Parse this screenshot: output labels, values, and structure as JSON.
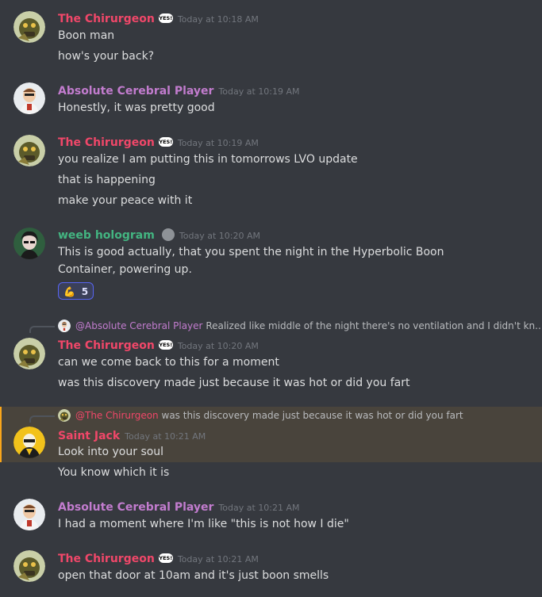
{
  "colors": {
    "chirurgeon": "#f04769",
    "absolute": "#c27cce",
    "weeb": "#43b581",
    "saintjack": "#f04769",
    "background": "#36393f",
    "mention_highlight": "#49443c"
  },
  "badge_text": "YES!",
  "messages": [
    {
      "author": "The Chirurgeon",
      "timestamp": "Today at 10:18 AM",
      "lines": [
        "Boon man",
        "how's your back?"
      ]
    },
    {
      "author": "Absolute Cerebral Player",
      "timestamp": "Today at 10:19 AM",
      "lines": [
        "Honestly, it was pretty good"
      ]
    },
    {
      "author": "The Chirurgeon",
      "timestamp": "Today at 10:19 AM",
      "lines": [
        "you realize I am putting this in tomorrows LVO update",
        "that is happening",
        "make your peace with it"
      ]
    },
    {
      "author": "weeb hologram",
      "timestamp": "Today at 10:20 AM",
      "lines": [
        "This is good actually, that you spent the night in the Hyperbolic Boon Container, powering up."
      ],
      "reaction": {
        "icon": "flexed-arm-icon",
        "count": "5"
      }
    },
    {
      "author": "The Chirurgeon",
      "timestamp": "Today at 10:20 AM",
      "reply": {
        "mention": "@Absolute Cerebral Player",
        "text": "Realized like middle of the night there's no ventilation and I didn't kn..."
      },
      "lines": [
        "can we come back to this for a moment",
        "was this discovery made just because it was hot or did you fart"
      ]
    },
    {
      "author": "Saint Jack",
      "timestamp": "Today at 10:21 AM",
      "reply": {
        "mention": "@The Chirurgeon",
        "text": "was this discovery made just because it was hot or did you fart"
      },
      "lines": [
        "Look into your soul",
        "You know which it is"
      ]
    },
    {
      "author": "Absolute Cerebral Player",
      "timestamp": "Today at 10:21 AM",
      "lines": [
        "I had a moment where I'm like \"this is not how I die\""
      ]
    },
    {
      "author": "The Chirurgeon",
      "timestamp": "Today at 10:21 AM",
      "lines": [
        "open that door at 10am and it's just boon smells"
      ]
    }
  ]
}
